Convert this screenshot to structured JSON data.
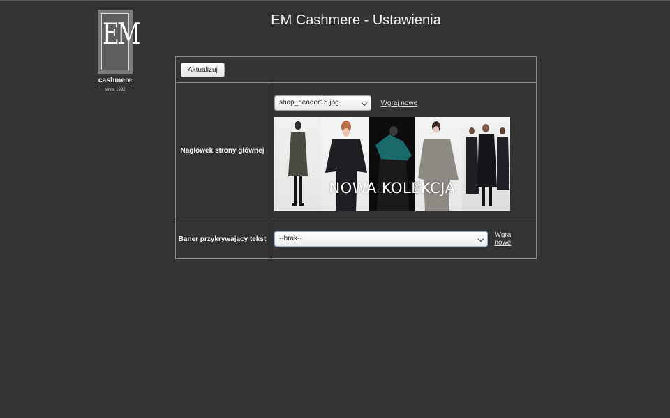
{
  "logo": {
    "monogram": "EM",
    "wordmark": "cashmere",
    "since": "since 1992"
  },
  "page": {
    "title": "EM Cashmere - Ustawienia"
  },
  "toolbar": {
    "update_label": "Aktualizuj"
  },
  "rows": {
    "header": {
      "label": "Nagłówek strony głównej",
      "selected_file": "shop_header15.jpg",
      "upload_label": "Wgraj nowe",
      "preview_caption": "NOWA KOLEKCJA"
    },
    "banner": {
      "label": "Baner przykrywający tekst",
      "selected_value": "--brak--",
      "upload_label": "Wgraj nowe"
    }
  }
}
